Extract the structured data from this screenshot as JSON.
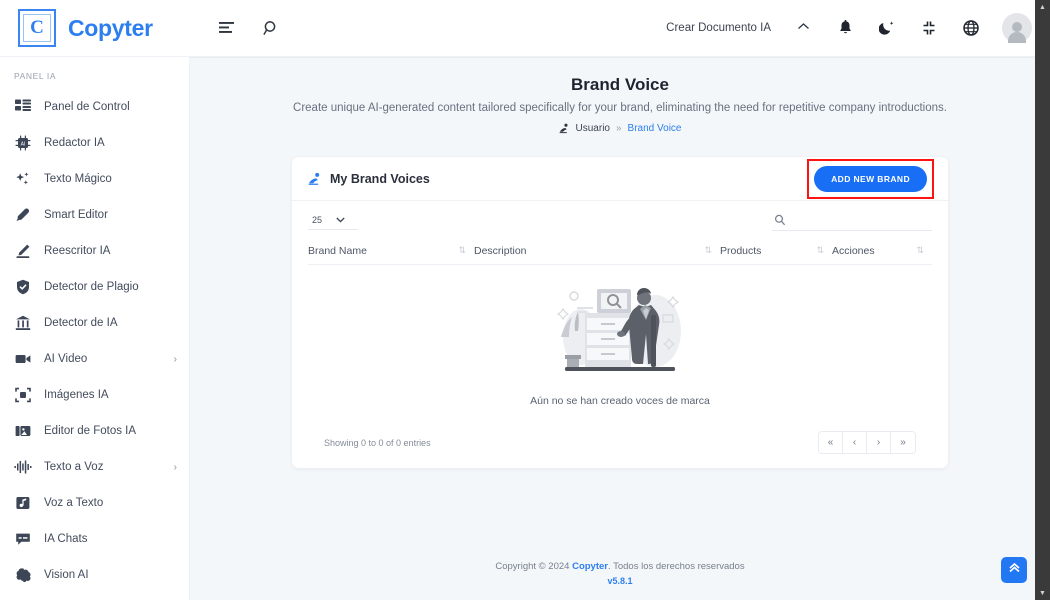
{
  "topbar": {
    "brand_name": "Copyter",
    "logo_letter": "C",
    "menu_icon": "menu-icon",
    "search_icon": "search-icon",
    "create_document_label": "Crear Documento IA",
    "chevron_up": "^",
    "icons": [
      "bell-icon",
      "moon-icon",
      "fullscreen-exit-icon",
      "globe-icon",
      "avatar"
    ]
  },
  "sidebar": {
    "section_label": "PANEL IA",
    "items": [
      {
        "label": "Panel de Control",
        "icon": "dashboard-icon",
        "arrow": ""
      },
      {
        "label": "Redactor IA",
        "icon": "chip-ai-icon",
        "arrow": ""
      },
      {
        "label": "Texto Mágico",
        "icon": "sparkles-icon",
        "arrow": ""
      },
      {
        "label": "Smart Editor",
        "icon": "pen-icon",
        "arrow": ""
      },
      {
        "label": "Reescritor IA",
        "icon": "pencil-icon",
        "arrow": ""
      },
      {
        "label": "Detector de Plagio",
        "icon": "shield-check-icon",
        "arrow": ""
      },
      {
        "label": "Detector de IA",
        "icon": "bank-icon",
        "arrow": ""
      },
      {
        "label": "AI Video",
        "icon": "video-camera-icon",
        "arrow": "›"
      },
      {
        "label": "Imágenes IA",
        "icon": "image-frame-icon",
        "arrow": ""
      },
      {
        "label": "Editor de Fotos IA",
        "icon": "photo-edit-icon",
        "arrow": ""
      },
      {
        "label": "Texto a Voz",
        "icon": "waveform-icon",
        "arrow": "›"
      },
      {
        "label": "Voz a Texto",
        "icon": "music-note-icon",
        "arrow": ""
      },
      {
        "label": "IA Chats",
        "icon": "chat-icon",
        "arrow": ""
      },
      {
        "label": "Vision AI",
        "icon": "brain-icon",
        "arrow": ""
      }
    ]
  },
  "page": {
    "title": "Brand Voice",
    "description": "Create unique AI-generated content tailored specifically for your brand, eliminating the need for repetitive company introductions.",
    "breadcrumb": {
      "icon": "user-voice-icon",
      "root": "Usuario",
      "separator": "»",
      "current": "Brand Voice"
    }
  },
  "card": {
    "title": "My Brand Voices",
    "title_icon": "brand-voice-icon",
    "add_button_label": "ADD NEW BRAND",
    "add_button_color": "#186ef5",
    "highlight_color": "#ff1212"
  },
  "table": {
    "page_length": "25",
    "page_length_caret": "⌄",
    "search_placeholder": "",
    "search_value": "",
    "search_icon": "search-icon",
    "columns": [
      {
        "label": "Brand Name",
        "sort_icon": "sort-icon"
      },
      {
        "label": "Description",
        "sort_icon": "sort-icon"
      },
      {
        "label": "Products",
        "sort_icon": "sort-icon"
      },
      {
        "label": "Acciones",
        "sort_icon": "sort-icon"
      }
    ],
    "rows": [],
    "empty_message": "Aún no se han creado voces de marca",
    "showing_text": "Showing 0 to 0 of 0 entries",
    "pagination": [
      "«",
      "‹",
      "›",
      "»"
    ]
  },
  "footer": {
    "copyright_prefix": "Copyright © 2024 ",
    "copyright_brand": "Copyter",
    "copyright_suffix": ". Todos los derechos reservados",
    "version": "v5.8.1"
  },
  "scroll_top": {
    "icon": "double-chevron-up-icon"
  }
}
